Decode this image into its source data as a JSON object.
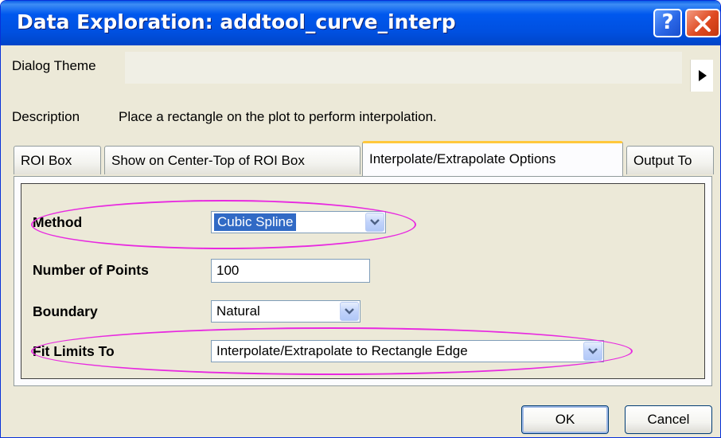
{
  "window": {
    "title": "Data Exploration: addtool_curve_interp"
  },
  "titlebar": {
    "help_label": "?"
  },
  "theme": {
    "label": "Dialog Theme"
  },
  "description": {
    "label": "Description",
    "text": "Place a rectangle on the plot to perform interpolation."
  },
  "tabs": [
    {
      "label": "ROI Box"
    },
    {
      "label": "Show on Center-Top of ROI Box"
    },
    {
      "label": "Interpolate/Extrapolate Options"
    },
    {
      "label": "Output To"
    }
  ],
  "form": {
    "method": {
      "label": "Method",
      "value": "Cubic Spline"
    },
    "points": {
      "label": "Number of Points",
      "value": "100"
    },
    "boundary": {
      "label": "Boundary",
      "value": "Natural"
    },
    "fit_limits": {
      "label": "Fit Limits To",
      "value": "Interpolate/Extrapolate to Rectangle Edge"
    }
  },
  "buttons": {
    "ok": "OK",
    "cancel": "Cancel"
  },
  "colors": {
    "titlebar": "#0055e5",
    "highlight_ellipse": "#e829e0",
    "selection": "#316ac5",
    "dialog_bg": "#ece9d8"
  }
}
